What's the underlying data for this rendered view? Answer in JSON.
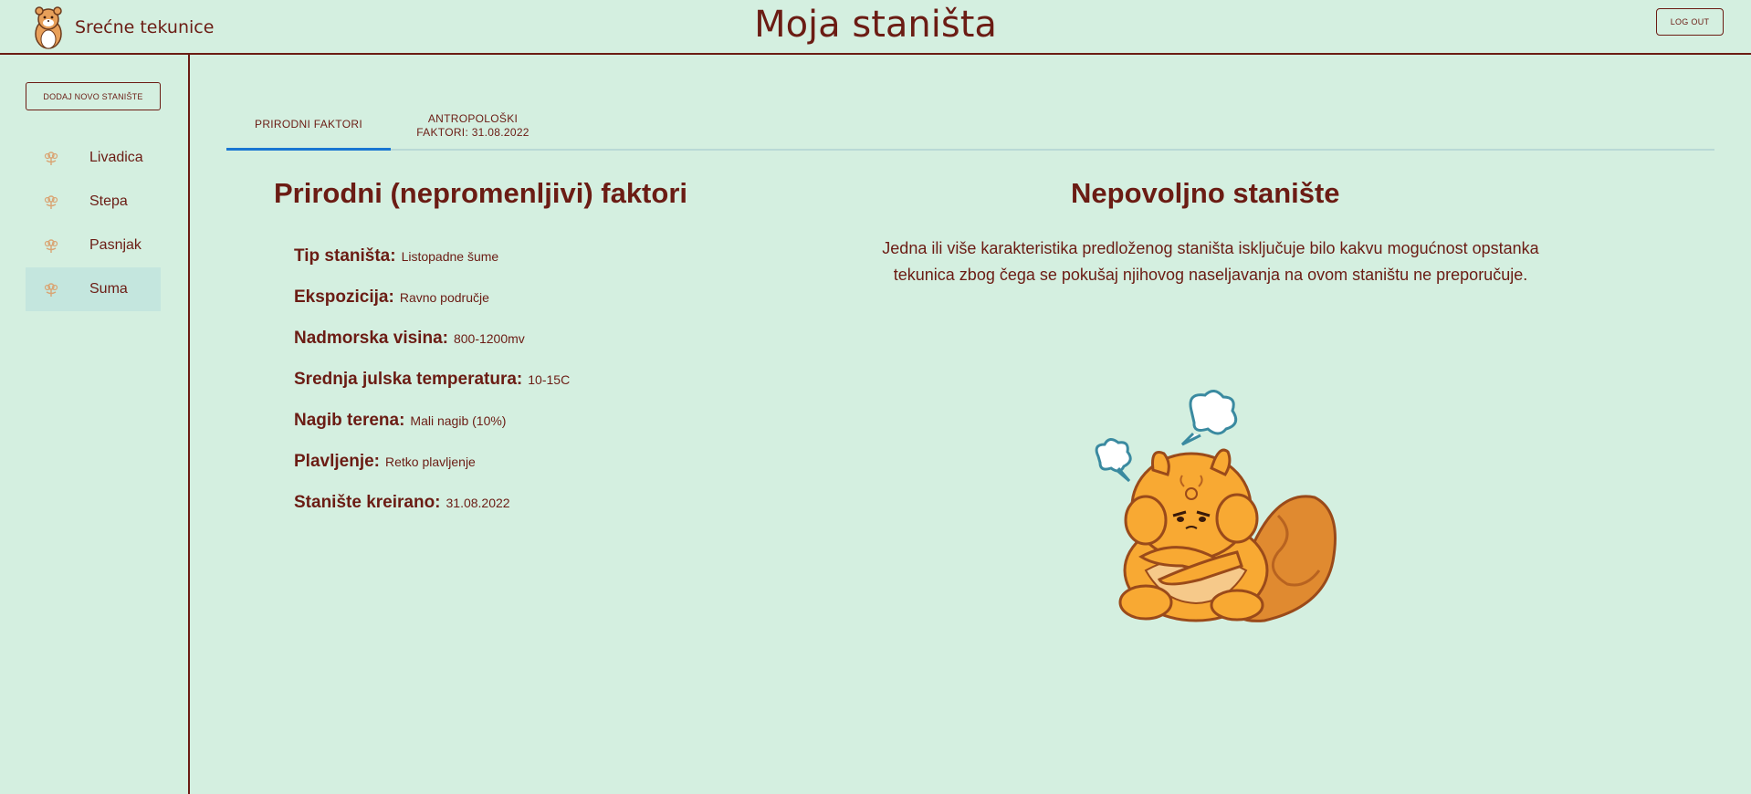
{
  "header": {
    "brand_name": "Srećne tekunice",
    "page_title": "Moja staništa",
    "logout_label": "LOG OUT"
  },
  "sidebar": {
    "add_button_label": "DODAJ NOVO STANIŠTE",
    "items": [
      {
        "label": "Livadica",
        "icon": "flower-icon",
        "active": false
      },
      {
        "label": "Stepa",
        "icon": "flower-icon",
        "active": false
      },
      {
        "label": "Pasnjak",
        "icon": "flower-icon",
        "active": false
      },
      {
        "label": "Suma",
        "icon": "flower-icon",
        "active": true
      }
    ]
  },
  "tabs": [
    {
      "label": "PRIRODNI FAKTORI",
      "active": true
    },
    {
      "label_line1": "ANTROPOLOŠKI",
      "label_line2": "FAKTORI: 31.08.2022",
      "active": false
    }
  ],
  "natural_factors": {
    "title": "Prirodni (nepromenljivi) faktori",
    "facts": [
      {
        "label": "Tip staništa:",
        "value": "Listopadne šume"
      },
      {
        "label": "Ekspozicija:",
        "value": "Ravno područje"
      },
      {
        "label": "Nadmorska visina:",
        "value": "800-1200mv"
      },
      {
        "label": "Srednja julska temperatura:",
        "value": "10-15C"
      },
      {
        "label": "Nagib terena:",
        "value": "Mali nagib (10%)"
      },
      {
        "label": "Plavljenje:",
        "value": "Retko plavljenje"
      },
      {
        "label": "Stanište kreirano:",
        "value": "31.08.2022"
      }
    ]
  },
  "assessment": {
    "title": "Nepovoljno stanište",
    "description": "Jedna ili više karakteristika predloženog staništa isključuje bilo kakvu mogućnost opstanka tekunica zbog čega se pokušaj njihovog naseljavanja na ovom staništu ne preporučuje.",
    "illustration": "angry-squirrel-illustration"
  },
  "colors": {
    "background": "#d4efe0",
    "text": "#6b1c14",
    "active_tab_indicator": "#1976d2",
    "active_nav": "#c4e6de"
  }
}
